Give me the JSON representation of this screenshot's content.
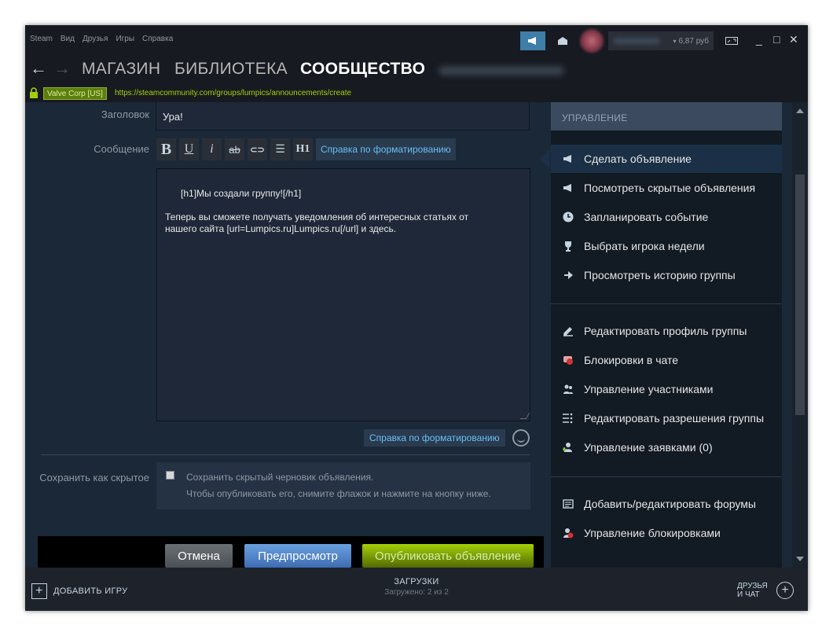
{
  "menu": [
    "Steam",
    "Вид",
    "Друзья",
    "Игры",
    "Справка"
  ],
  "account": {
    "balance": "6,87 руб"
  },
  "nav": {
    "tabs": [
      "МАГАЗИН",
      "БИБЛИОТЕКА",
      "СООБЩЕСТВО"
    ],
    "active_tab": "СООБЩЕСТВО"
  },
  "urlbar": {
    "cert": "Valve Corp [US]",
    "url": "https://steamcommunity.com/groups/lumpics/announcements/create"
  },
  "form": {
    "title_label": "Заголовок",
    "title_value": "Ура!",
    "message_label": "Сообщение",
    "toolbar": {
      "bold": "B",
      "underline": "U",
      "italic": "i",
      "strike": "ab",
      "link": "⊂⊃",
      "list": "☰",
      "heading": "H1"
    },
    "format_help": "Справка по форматированию",
    "message_value": "[h1]Мы создали группу![/h1]\n\nТеперь вы сможете получать уведомления об интересных статьях от\nнашего сайта [url=Lumpics.ru]Lumpics.ru[/url] и здесь.",
    "hidden_label": "Сохранить как скрытое",
    "hidden_line1": "Сохранить скрытый черновик объявления.",
    "hidden_line2": "Чтобы опубликовать его, снимите флажок и нажмите на кнопку ниже.",
    "hidden_checked": false,
    "buttons": {
      "cancel": "Отмена",
      "preview": "Предпросмотр",
      "publish": "Опубликовать объявление"
    }
  },
  "sidebar": {
    "header": "УПРАВЛЕНИЕ",
    "group1": [
      {
        "label": "Сделать объявление",
        "icon": "megaphone-icon",
        "active": true
      },
      {
        "label": "Посмотреть скрытые объявления",
        "icon": "megaphone-icon"
      },
      {
        "label": "Запланировать событие",
        "icon": "clock-icon"
      },
      {
        "label": "Выбрать игрока недели",
        "icon": "trophy-icon"
      },
      {
        "label": "Просмотреть историю группы",
        "icon": "history-icon"
      }
    ],
    "group2": [
      {
        "label": "Редактировать профиль группы",
        "icon": "pencil-icon"
      },
      {
        "label": "Блокировки в чате",
        "icon": "chat-block-icon"
      },
      {
        "label": "Управление участниками",
        "icon": "members-icon"
      },
      {
        "label": "Редактировать разрешения группы",
        "icon": "permissions-icon"
      },
      {
        "label": "Управление заявками (0)",
        "icon": "add-user-icon"
      }
    ],
    "group3": [
      {
        "label": "Добавить/редактировать форумы",
        "icon": "forum-icon"
      },
      {
        "label": "Управление блокировками",
        "icon": "ban-user-icon"
      }
    ]
  },
  "bottombar": {
    "add_game": "ДОБАВИТЬ ИГРУ",
    "downloads_title": "ЗАГРУЗКИ",
    "downloads_status": "Загружено: 2 из 2",
    "friends_line1": "ДРУЗЬЯ",
    "friends_line2": "И ЧАТ"
  },
  "colors": {
    "accent": "#66c0f4",
    "publish": "#a4d007",
    "bg": "#1b2838"
  }
}
